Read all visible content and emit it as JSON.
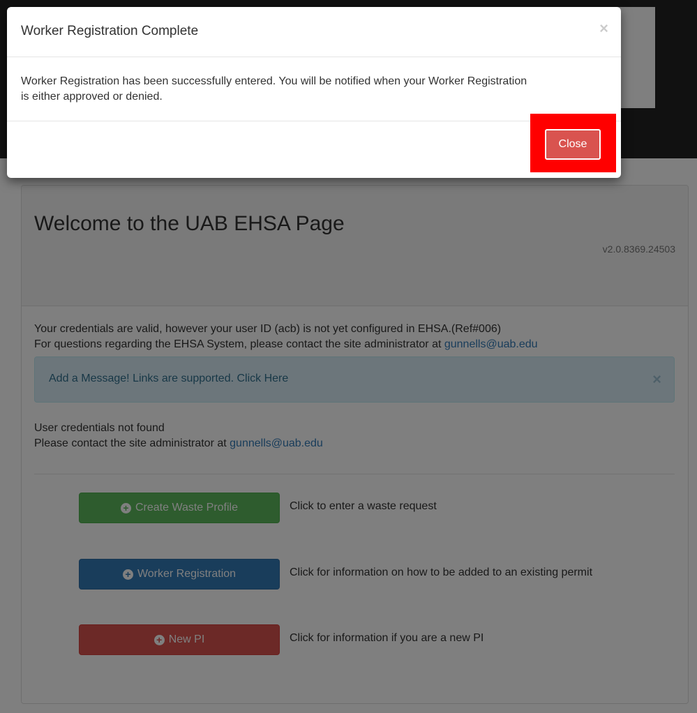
{
  "modal": {
    "title": "Worker Registration Complete",
    "close_symbol": "×",
    "message_line1": "Worker Registration has been successfully entered. You will be notified when your Worker Registration",
    "message_line2": "is either approved or denied.",
    "close_button_label": "Close"
  },
  "page": {
    "title": "Welcome to the UAB EHSA Page",
    "version": "v2.0.8369.24503",
    "credentials_line": "Your credentials are valid, however your user ID (acb) is not yet configured in EHSA.(Ref#006)",
    "questions_prefix": "For questions regarding the EHSA System, please contact the site administrator at ",
    "admin_email": "gunnells@uab.edu",
    "alert": {
      "text": "Add a Message! Links are supported. Click Here",
      "close_symbol": "×"
    },
    "not_found_line": "User credentials not found",
    "contact_prefix": "Please contact the site administrator at ",
    "contact_email": "gunnells@uab.edu",
    "actions": [
      {
        "label": "Create Waste Profile",
        "description": "Click to enter a waste request"
      },
      {
        "label": "Worker Registration",
        "description": "Click for information on how to be added to an existing permit"
      },
      {
        "label": "New PI",
        "description": "Click for information if you are a new PI"
      }
    ]
  },
  "icons": {
    "button_icon": "plus-circle-icon",
    "plus_glyph": "+"
  },
  "colors": {
    "success": "#5cb85c",
    "primary": "#337ab7",
    "danger": "#d9534f",
    "highlight": "#ff0000"
  }
}
